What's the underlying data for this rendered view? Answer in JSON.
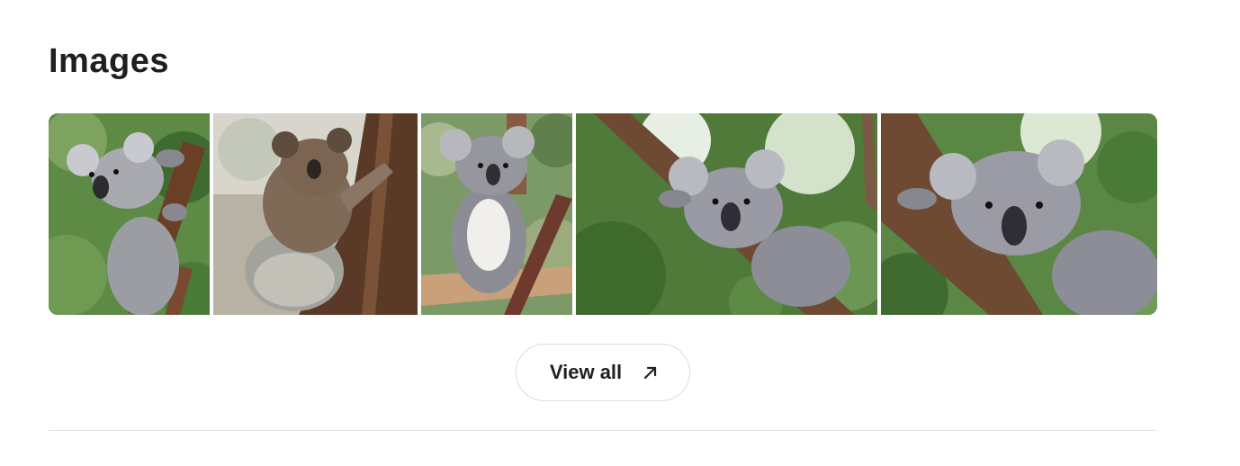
{
  "section": {
    "title": "Images",
    "view_all_label": "View all",
    "view_all_icon": "arrow-up-right-icon"
  },
  "images": [
    {
      "subject": "koala",
      "icon": "koala-image"
    },
    {
      "subject": "koala",
      "icon": "koala-image"
    },
    {
      "subject": "koala",
      "icon": "koala-image"
    },
    {
      "subject": "koala",
      "icon": "koala-image"
    },
    {
      "subject": "koala",
      "icon": "koala-image"
    }
  ],
  "colors": {
    "background": "#ffffff",
    "text": "#202124",
    "border": "#dadce0",
    "divider": "#e3e3e3",
    "foliage": "#4f7a3a",
    "koala_fur": "#8e8f96",
    "bark": "#6b4a35"
  }
}
